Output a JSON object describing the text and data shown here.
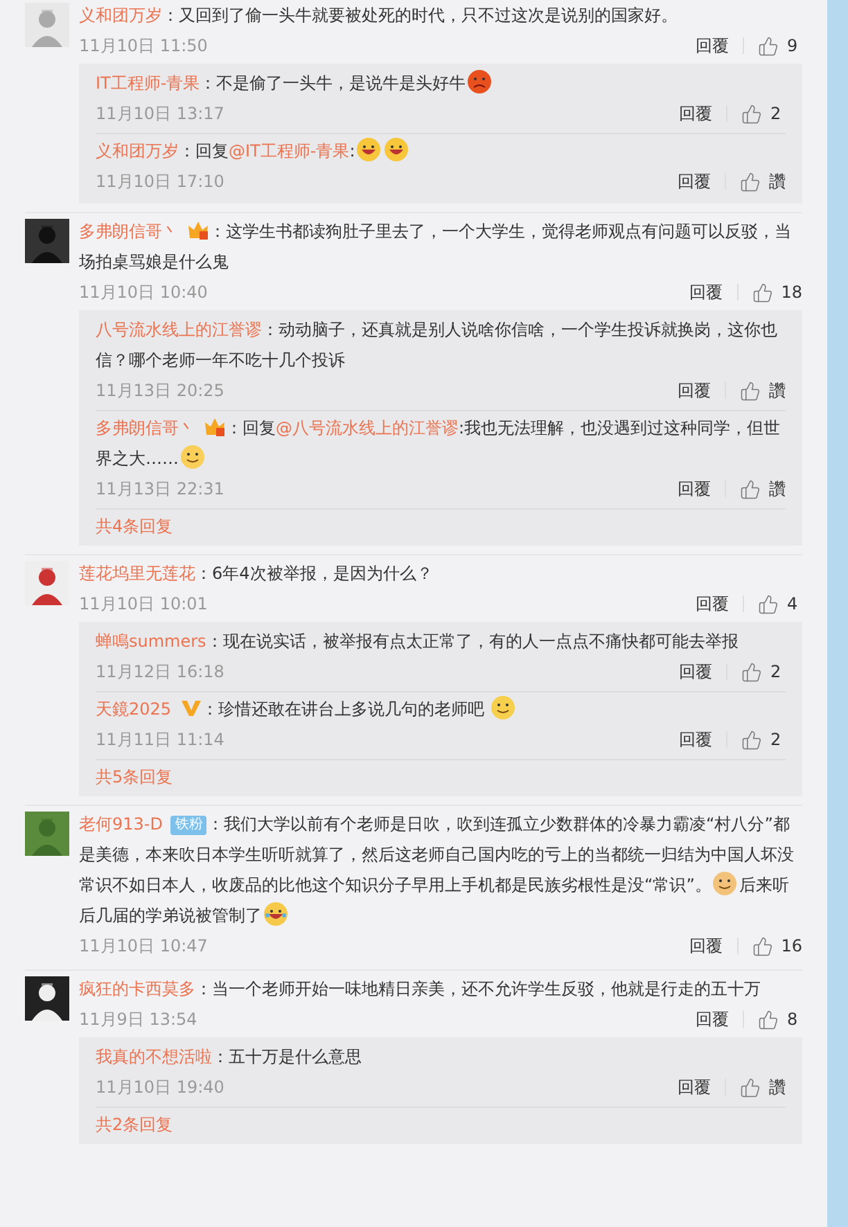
{
  "comments": [
    {
      "user": {
        "name": "义和团万岁"
      },
      "segments": [
        {
          "kind": "text",
          "text": "：又回到了偷一头牛就要被处死的时代，只不过这次是说别的国家好。"
        }
      ],
      "time": "11月10日 11:50",
      "reply_label": "回覆",
      "likes": "9",
      "replies": [
        {
          "user": {
            "name": "IT工程师-青果"
          },
          "segments": [
            {
              "kind": "text",
              "text": "：不是偷了一头牛，是说牛是头好牛"
            },
            {
              "kind": "angry"
            }
          ],
          "time": "11月10日 13:17",
          "reply_label": "回覆",
          "likes": "2"
        },
        {
          "user": {
            "name": "义和团万岁"
          },
          "segments": [
            {
              "kind": "text",
              "text": "：回复"
            },
            {
              "kind": "mention",
              "text": "@IT工程师-青果"
            },
            {
              "kind": "text",
              "text": ":"
            },
            {
              "kind": "laugh"
            },
            {
              "kind": "laugh"
            }
          ],
          "time": "11月10日 17:10",
          "reply_label": "回覆",
          "likes": "讚"
        }
      ]
    },
    {
      "user": {
        "name": "多弗朗信哥丶",
        "badge": {
          "kind": "crown"
        }
      },
      "segments": [
        {
          "kind": "text",
          "text": "：这学生书都读狗肚子里去了，一个大学生，觉得老师观点有问题可以反驳，当场拍桌骂娘是什么鬼"
        }
      ],
      "time": "11月10日 10:40",
      "reply_label": "回覆",
      "likes": "18",
      "replies": [
        {
          "user": {
            "name": "八号流水线上的江誉谬"
          },
          "segments": [
            {
              "kind": "text",
              "text": "：动动脑子，还真就是别人说啥你信啥，一个学生投诉就换岗，这你也信？哪个老师一年不吃十几个投诉"
            }
          ],
          "time": "11月13日 20:25",
          "reply_label": "回覆",
          "likes": "讚"
        },
        {
          "user": {
            "name": "多弗朗信哥丶",
            "badge": {
              "kind": "crown"
            }
          },
          "segments": [
            {
              "kind": "text",
              "text": "：回复"
            },
            {
              "kind": "mention",
              "text": "@八号流水线上的江誉谬"
            },
            {
              "kind": "text",
              "text": ":我也无法理解，也没遇到过这种同学，但世界之大……"
            },
            {
              "kind": "yum"
            }
          ],
          "time": "11月13日 22:31",
          "reply_label": "回覆",
          "likes": "讚"
        }
      ],
      "more": "共4条回复"
    },
    {
      "user": {
        "name": "莲花坞里无莲花"
      },
      "segments": [
        {
          "kind": "text",
          "text": "：6年4次被举报，是因为什么？"
        }
      ],
      "time": "11月10日 10:01",
      "reply_label": "回覆",
      "likes": "4",
      "replies": [
        {
          "user": {
            "name": "蝉鳴summers"
          },
          "segments": [
            {
              "kind": "text",
              "text": "：现在说实话，被举报有点太正常了，有的人一点点不痛快都可能去举报"
            }
          ],
          "time": "11月12日 16:18",
          "reply_label": "回覆",
          "likes": "2"
        },
        {
          "user": {
            "name": "天鏡2025",
            "badge": {
              "kind": "vip"
            }
          },
          "segments": [
            {
              "kind": "text",
              "text": "：珍惜还敢在讲台上多说几句的老师吧 "
            },
            {
              "kind": "smile"
            }
          ],
          "time": "11月11日 11:14",
          "reply_label": "回覆",
          "likes": "2"
        }
      ],
      "more": "共5条回复"
    },
    {
      "user": {
        "name": "老何913-D",
        "badge": {
          "kind": "fan",
          "text": "铁粉"
        }
      },
      "segments": [
        {
          "kind": "text",
          "text": "：我们大学以前有个老师是日吹，吹到连孤立少数群体的冷暴力霸凌“村八分”都是美德，本来吹日本学生听听就算了，然后这老师自己国内吃的亏上的当都统一归结为中国人坏没常识不如日本人，收废品的比他这个知识分子早用上手机都是民族劣根性是没“常识”。"
        },
        {
          "kind": "doge"
        },
        {
          "kind": "text",
          "text": "后来听后几届的学弟说被管制了"
        },
        {
          "kind": "tears"
        }
      ],
      "time": "11月10日 10:47",
      "reply_label": "回覆",
      "likes": "16"
    },
    {
      "user": {
        "name": "疯狂的卡西莫多"
      },
      "segments": [
        {
          "kind": "text",
          "text": "：当一个老师开始一味地精日亲美，还不允许学生反驳，他就是行走的五十万"
        }
      ],
      "time": "11月9日 13:54",
      "reply_label": "回覆",
      "likes": "8",
      "replies": [
        {
          "user": {
            "name": "我真的不想活啦"
          },
          "segments": [
            {
              "kind": "text",
              "text": "：五十万是什么意思"
            }
          ],
          "time": "11月10日 19:40",
          "reply_label": "回覆",
          "likes": "讚"
        }
      ],
      "more": "共2条回复"
    }
  ]
}
